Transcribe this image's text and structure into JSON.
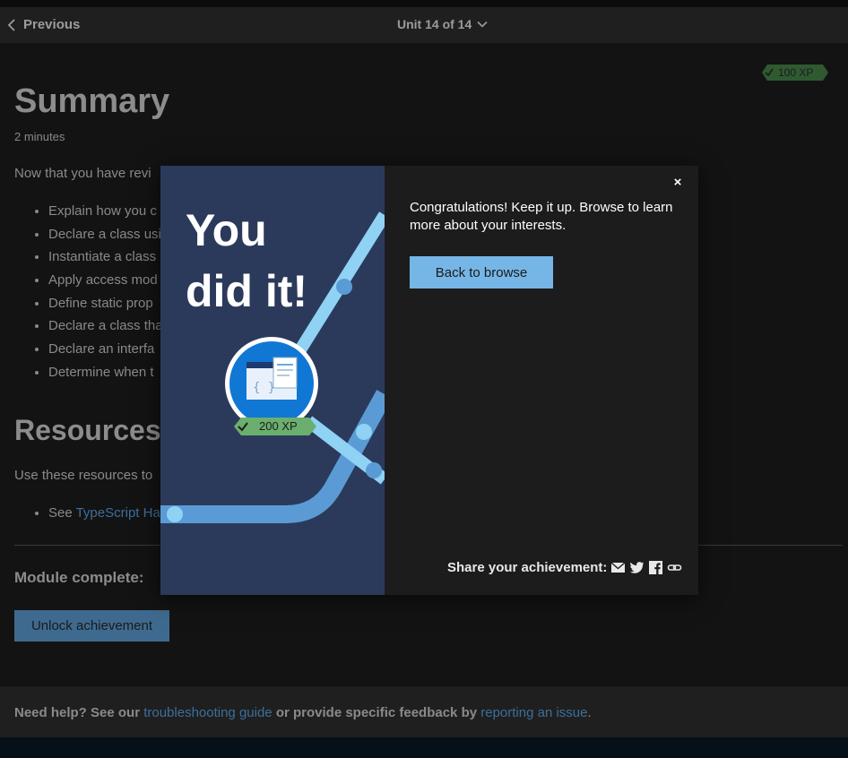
{
  "nav": {
    "previous_label": "Previous",
    "unit_label": "Unit 14 of 14"
  },
  "xp_badge": "100 XP",
  "page": {
    "title": "Summary",
    "duration": "2 minutes",
    "intro": "Now that you have revi",
    "objectives": [
      "Explain how you c",
      "Declare a class usi",
      "Instantiate a class",
      "Apply access mod",
      "Define static prop",
      "Declare a class tha",
      "Declare an interfa",
      "Determine when t"
    ],
    "resources_title": "Resources",
    "resources_intro": "Use these resources to",
    "resource_item_prefix": "See ",
    "resource_link": "TypeScript Ha",
    "module_complete": "Module complete:",
    "unlock_button": "Unlock achievement"
  },
  "footer": {
    "prefix": "Need help? See our ",
    "troubleshooting_link": "troubleshooting guide",
    "middle": " or provide specific feedback by ",
    "report_link": "reporting an issue",
    "suffix": "."
  },
  "modal": {
    "headline_line1": "You",
    "headline_line2": "did it!",
    "medal_xp": "200 XP",
    "close_glyph": "×",
    "message": "Congratulations! Keep it up. Browse to learn more about your interests.",
    "back_button": "Back to browse",
    "share_label": "Share your achievement:",
    "share_icons": [
      "mail-icon",
      "twitter-icon",
      "facebook-icon",
      "link-icon"
    ]
  },
  "colors": {
    "accent": "#75b6e7",
    "modal_art_bg": "#2b3a5b",
    "xp_badge_green": "#5fa760",
    "link": "#3c6f9c"
  }
}
